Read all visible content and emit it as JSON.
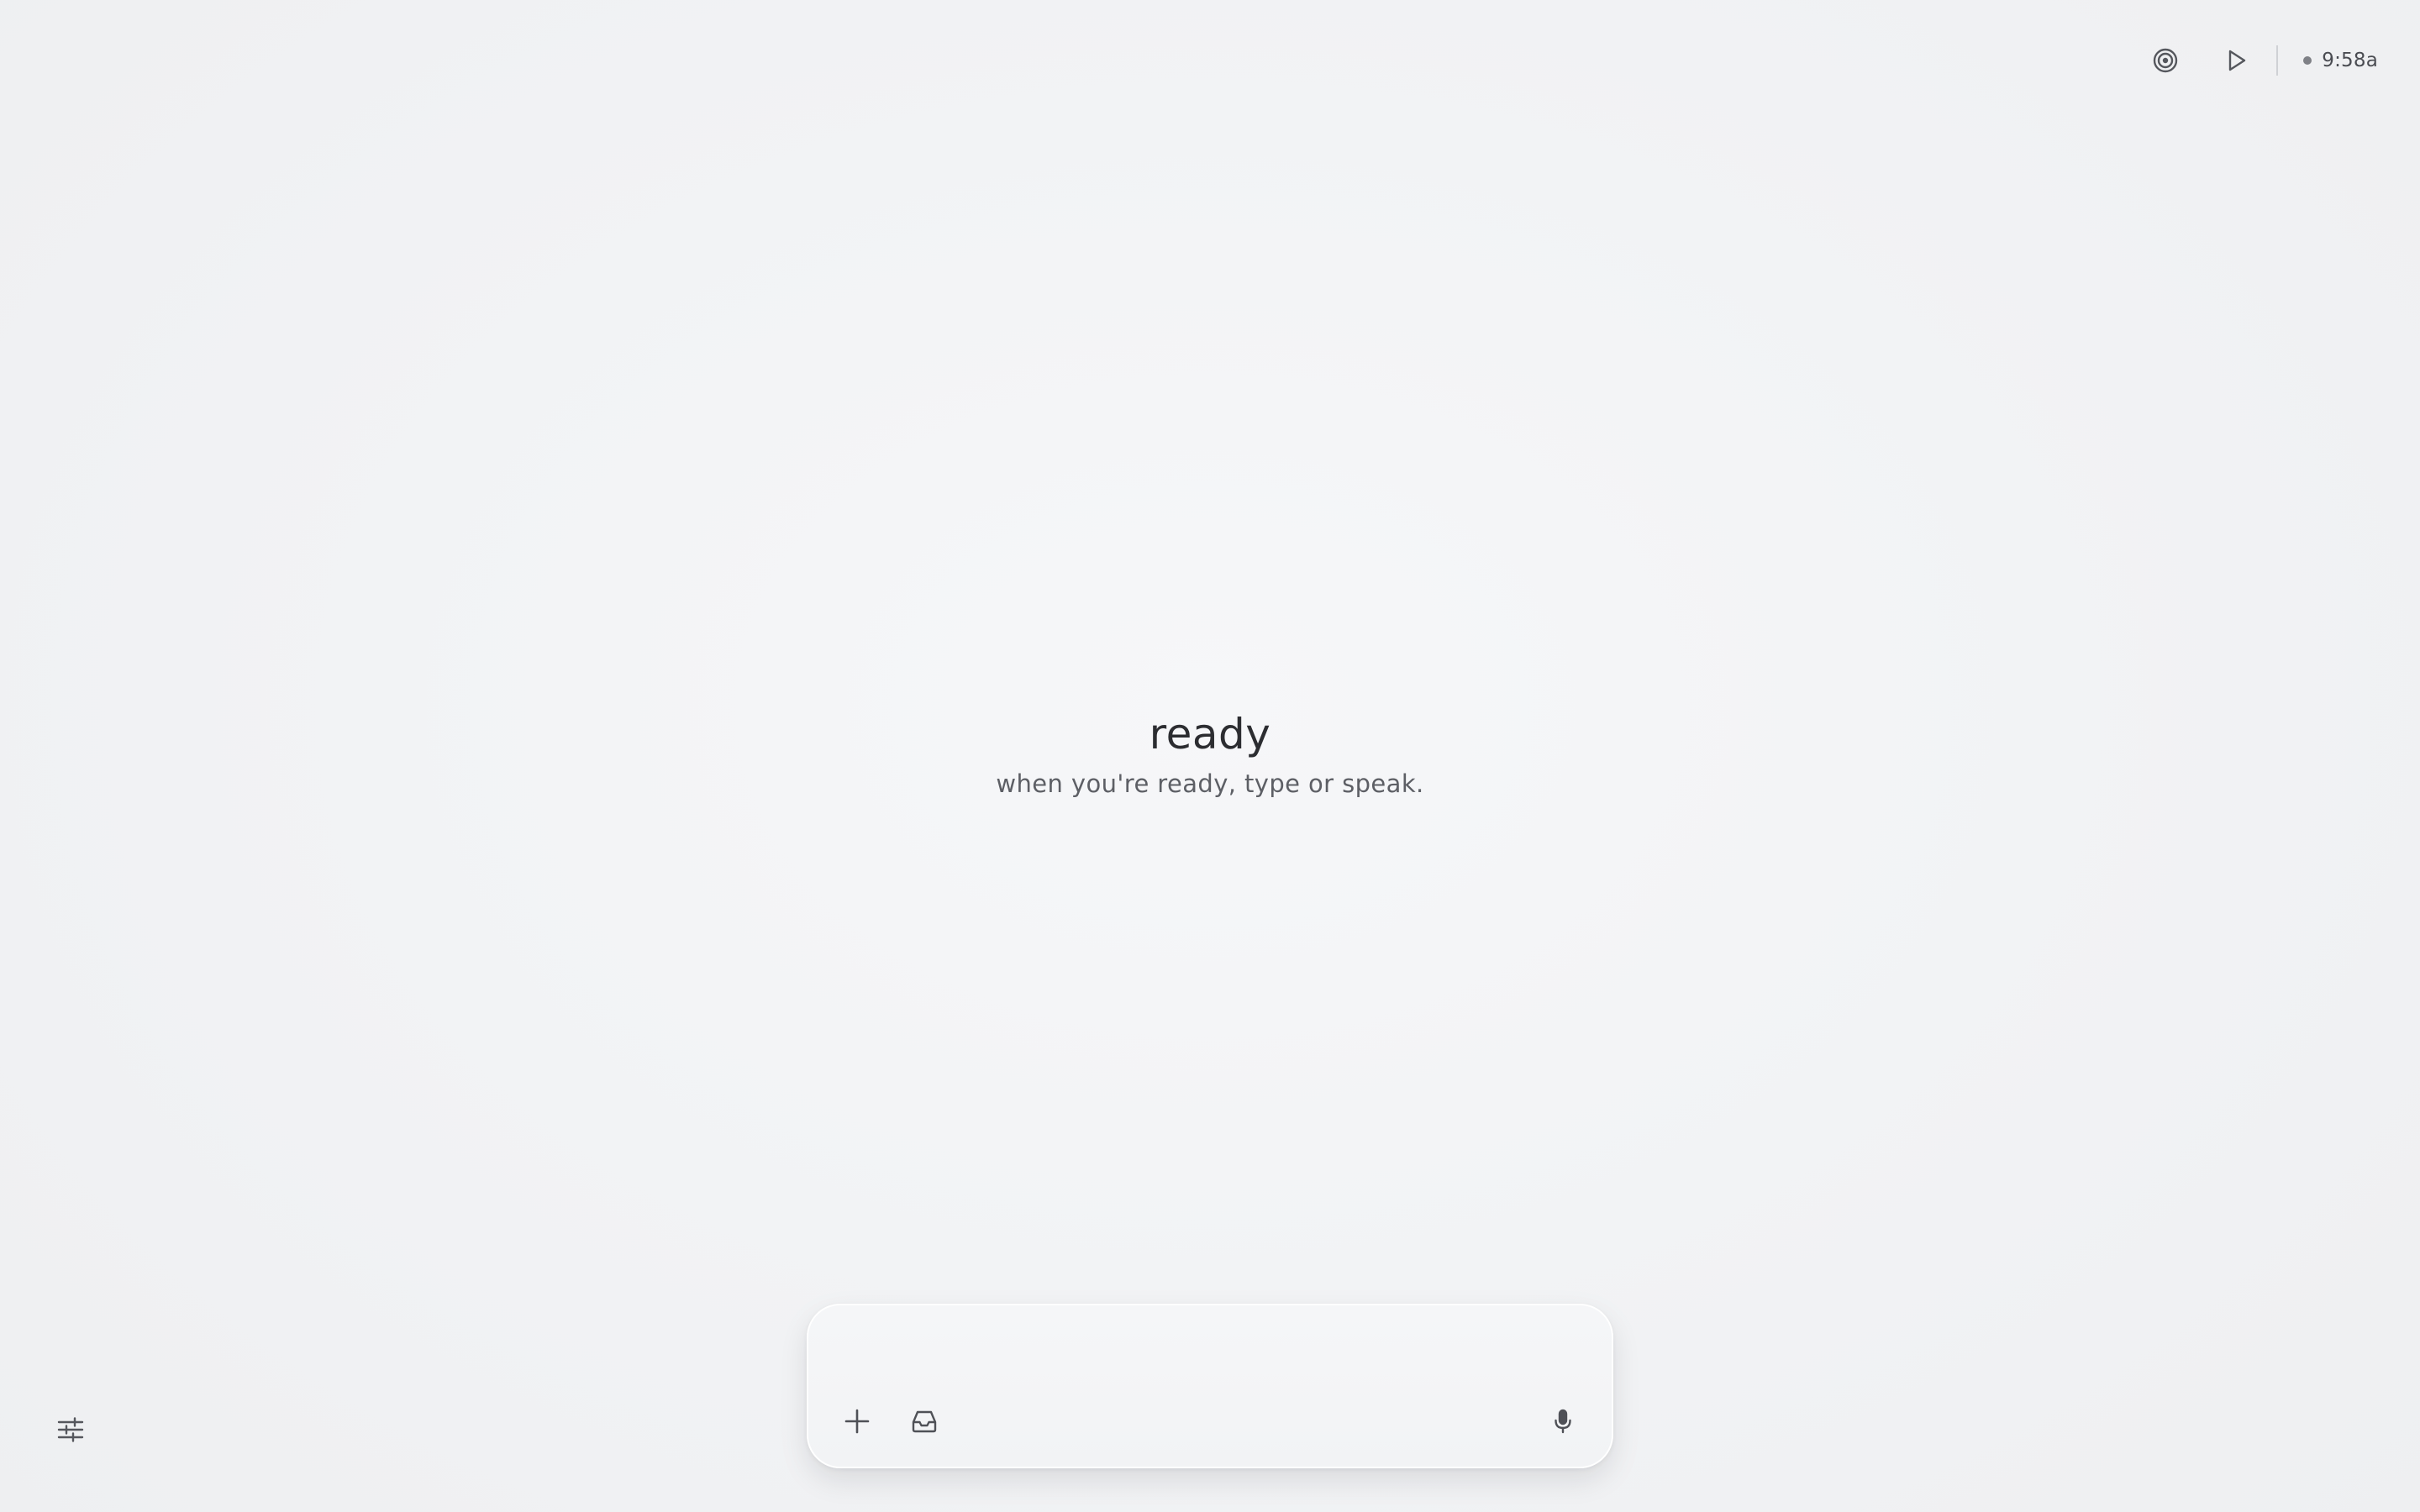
{
  "header": {
    "target_icon": "target-icon",
    "play_icon": "play-icon",
    "status_dot_color": "#7e8086",
    "time": "9:58a"
  },
  "empty_state": {
    "title": "ready",
    "subtitle": "when you're ready, type or speak."
  },
  "composer": {
    "placeholder": "",
    "value": "",
    "add_icon": "plus-icon",
    "inbox_icon": "inbox-icon",
    "mic_icon": "microphone-icon"
  },
  "footer": {
    "settings_icon": "sliders-icon"
  },
  "colors": {
    "background": "#f3f4f6",
    "text_primary": "#2c2d31",
    "text_secondary": "#5d5f65",
    "icon": "#55575d"
  }
}
